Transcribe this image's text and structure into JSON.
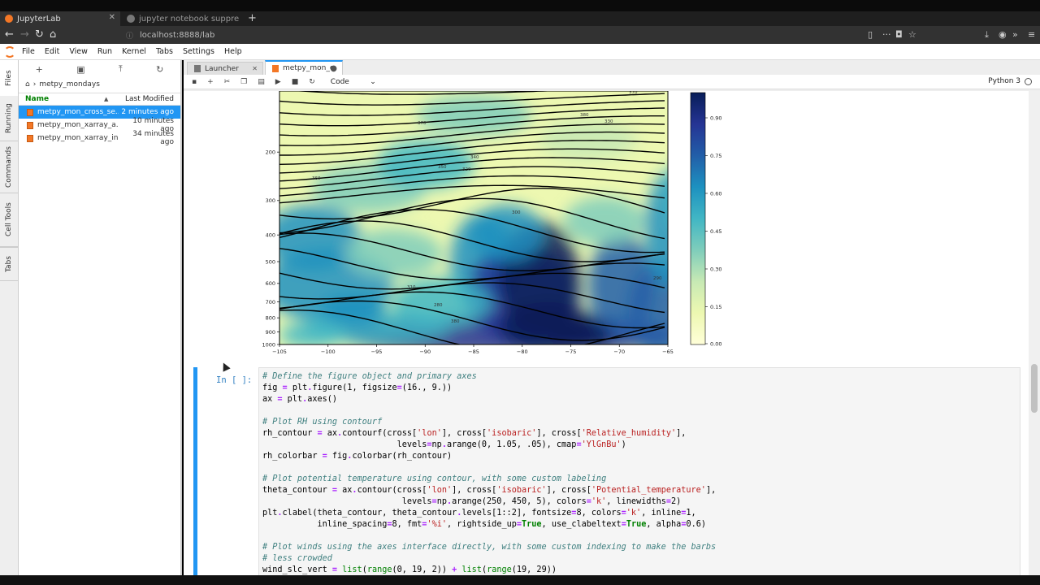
{
  "browser": {
    "tabs": [
      {
        "title": "JupyterLab",
        "active": true
      },
      {
        "title": "jupyter notebook suppress",
        "active": false
      }
    ],
    "new_tab": "+",
    "url": "localhost:8888/lab"
  },
  "menubar": [
    "File",
    "Edit",
    "View",
    "Run",
    "Kernel",
    "Tabs",
    "Settings",
    "Help"
  ],
  "left_tabs": [
    "Files",
    "Running",
    "Commands",
    "Cell Tools",
    "Tabs"
  ],
  "file_browser": {
    "breadcrumb": "metpy_mondays",
    "col_name": "Name",
    "col_modified": "Last Modified",
    "files": [
      {
        "name": "metpy_mon_cross_se...",
        "modified": "2 minutes ago",
        "selected": true
      },
      {
        "name": "metpy_mon_xarray_a...",
        "modified": "10 minutes ago",
        "selected": false
      },
      {
        "name": "metpy_mon_xarray_in...",
        "modified": "34 minutes ago",
        "selected": false
      }
    ]
  },
  "doc_tabs": [
    {
      "title": "Launcher",
      "active": false
    },
    {
      "title": "metpy_mon_cr",
      "active": true
    }
  ],
  "notebook_toolbar": {
    "cell_type": "Code",
    "kernel": "Python 3"
  },
  "chart_data": {
    "type": "contour",
    "x_ticks": [
      "-105",
      "-100",
      "-95",
      "-90",
      "-85",
      "-80",
      "-75",
      "-70",
      "-65"
    ],
    "y_ticks": [
      "200",
      "300",
      "400",
      "500",
      "600",
      "700",
      "800",
      "900",
      "1000"
    ],
    "colorbar_ticks": [
      "0.90",
      "0.75",
      "0.60",
      "0.45",
      "0.30",
      "0.15",
      "0.00"
    ],
    "colormap": [
      "#ffffd9",
      "#edf8b1",
      "#c7e9b4",
      "#7fcdbb",
      "#41b6c4",
      "#1d91c0",
      "#225ea8",
      "#253494",
      "#081d58"
    ],
    "contour_labels": [
      "380",
      "370",
      "330",
      "360",
      "340",
      "350",
      "320",
      "300",
      "310",
      "290",
      "280"
    ]
  },
  "cell": {
    "prompt": "In [ ]:",
    "lines": [
      [
        [
          "c",
          "# Define the figure object and primary axes"
        ]
      ],
      [
        [
          "",
          "fig "
        ],
        [
          "o",
          "="
        ],
        [
          "",
          " plt"
        ],
        [
          "o",
          "."
        ],
        [
          "",
          "figure(1, figsize"
        ],
        [
          "o",
          "="
        ],
        [
          "",
          "(16., 9.))"
        ]
      ],
      [
        [
          "",
          "ax "
        ],
        [
          "o",
          "="
        ],
        [
          "",
          " plt"
        ],
        [
          "o",
          "."
        ],
        [
          "",
          "axes()"
        ]
      ],
      [
        [
          "",
          ""
        ]
      ],
      [
        [
          "c",
          "# Plot RH using contourf"
        ]
      ],
      [
        [
          "",
          "rh_contour "
        ],
        [
          "o",
          "="
        ],
        [
          "",
          " ax"
        ],
        [
          "o",
          "."
        ],
        [
          "",
          "contourf(cross["
        ],
        [
          "s",
          "'lon'"
        ],
        [
          "",
          "], cross["
        ],
        [
          "s",
          "'isobaric'"
        ],
        [
          "",
          "], cross["
        ],
        [
          "s",
          "'Relative_humidity'"
        ],
        [
          "",
          "],"
        ]
      ],
      [
        [
          "",
          "                           levels"
        ],
        [
          "o",
          "="
        ],
        [
          "",
          "np"
        ],
        [
          "o",
          "."
        ],
        [
          "",
          "arange(0, 1.05, .05), cmap"
        ],
        [
          "o",
          "="
        ],
        [
          "s",
          "'YlGnBu'"
        ],
        [
          "",
          ")"
        ]
      ],
      [
        [
          "",
          "rh_colorbar "
        ],
        [
          "o",
          "="
        ],
        [
          "",
          " fig"
        ],
        [
          "o",
          "."
        ],
        [
          "",
          "colorbar(rh_contour)"
        ]
      ],
      [
        [
          "",
          ""
        ]
      ],
      [
        [
          "c",
          "# Plot potential temperature using contour, with some custom labeling"
        ]
      ],
      [
        [
          "",
          "theta_contour "
        ],
        [
          "o",
          "="
        ],
        [
          "",
          " ax"
        ],
        [
          "o",
          "."
        ],
        [
          "",
          "contour(cross["
        ],
        [
          "s",
          "'lon'"
        ],
        [
          "",
          "], cross["
        ],
        [
          "s",
          "'isobaric'"
        ],
        [
          "",
          "], cross["
        ],
        [
          "s",
          "'Potential_temperature'"
        ],
        [
          "",
          "],"
        ]
      ],
      [
        [
          "",
          "                            levels"
        ],
        [
          "o",
          "="
        ],
        [
          "",
          "np"
        ],
        [
          "o",
          "."
        ],
        [
          "",
          "arange(250, 450, 5), colors"
        ],
        [
          "o",
          "="
        ],
        [
          "s",
          "'k'"
        ],
        [
          "",
          ", linewidths"
        ],
        [
          "o",
          "="
        ],
        [
          "",
          "2)"
        ]
      ],
      [
        [
          "",
          "plt"
        ],
        [
          "o",
          "."
        ],
        [
          "",
          "clabel(theta_contour, theta_contour"
        ],
        [
          "o",
          "."
        ],
        [
          "",
          "levels[1::2], fontsize"
        ],
        [
          "o",
          "="
        ],
        [
          "",
          "8, colors"
        ],
        [
          "o",
          "="
        ],
        [
          "s",
          "'k'"
        ],
        [
          "",
          ", inline"
        ],
        [
          "o",
          "="
        ],
        [
          "",
          "1,"
        ]
      ],
      [
        [
          "",
          "           inline_spacing"
        ],
        [
          "o",
          "="
        ],
        [
          "",
          "8, fmt"
        ],
        [
          "o",
          "="
        ],
        [
          "s",
          "'%i'"
        ],
        [
          "",
          ", rightside_up"
        ],
        [
          "o",
          "="
        ],
        [
          "k",
          "True"
        ],
        [
          "",
          ", use_clabeltext"
        ],
        [
          "o",
          "="
        ],
        [
          "k",
          "True"
        ],
        [
          "",
          ", alpha"
        ],
        [
          "o",
          "="
        ],
        [
          "",
          "0.6)"
        ]
      ],
      [
        [
          "",
          ""
        ]
      ],
      [
        [
          "c",
          "# Plot winds using the axes interface directly, with some custom indexing to make the barbs"
        ]
      ],
      [
        [
          "c",
          "# less crowded"
        ]
      ],
      [
        [
          "",
          "wind_slc_vert "
        ],
        [
          "o",
          "="
        ],
        [
          "",
          " "
        ],
        [
          "n",
          "list"
        ],
        [
          "",
          "("
        ],
        [
          "n",
          "range"
        ],
        [
          "",
          "(0, 19, 2)) "
        ],
        [
          "o",
          "+"
        ],
        [
          "",
          " "
        ],
        [
          "n",
          "list"
        ],
        [
          "",
          "("
        ],
        [
          "n",
          "range"
        ],
        [
          "",
          "(19, 29))"
        ]
      ]
    ]
  }
}
